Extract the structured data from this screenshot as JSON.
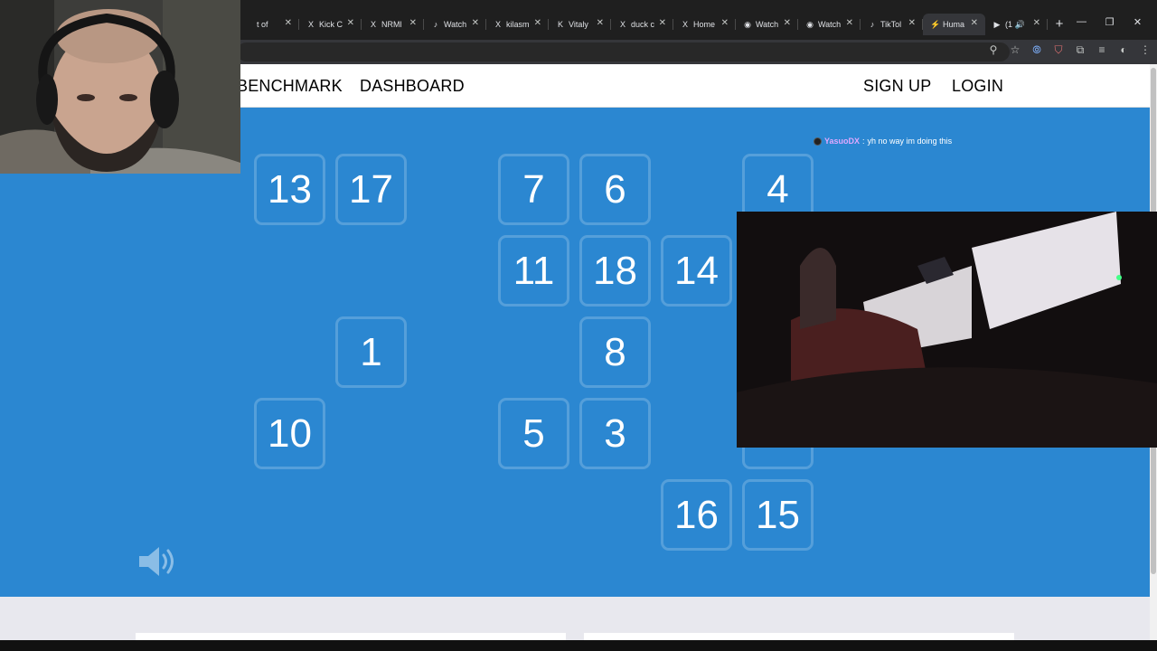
{
  "browser": {
    "tabs": [
      {
        "icon": "",
        "label": "t of",
        "active": false
      },
      {
        "icon": "X",
        "label": "Kick C",
        "active": false
      },
      {
        "icon": "X",
        "label": "NRMl",
        "active": false
      },
      {
        "icon": "♪",
        "label": "Watch",
        "active": false
      },
      {
        "icon": "X",
        "label": "kilasm",
        "active": false
      },
      {
        "icon": "K",
        "label": "Vitaly",
        "active": false
      },
      {
        "icon": "X",
        "label": "duck c",
        "active": false
      },
      {
        "icon": "X",
        "label": "Home",
        "active": false
      },
      {
        "icon": "◉",
        "label": "Watch",
        "active": false
      },
      {
        "icon": "◉",
        "label": "Watch",
        "active": false
      },
      {
        "icon": "♪",
        "label": "TikTol",
        "active": false
      },
      {
        "icon": "⚡",
        "label": "Huma",
        "active": true
      },
      {
        "icon": "▶",
        "label": "(1 🔊",
        "active": false
      }
    ],
    "new_tab": "+",
    "window_controls": [
      "—",
      "❐",
      "✕"
    ],
    "toolbar_icons": [
      "zoom-icon",
      "star-icon",
      "extension-icon",
      "extension-icon",
      "puzzle-icon",
      "media-icon",
      "profile-icon",
      "menu-icon"
    ]
  },
  "nav": {
    "benchmark": "BENCHMARK",
    "dashboard": "DASHBOARD",
    "signup": "SIGN UP",
    "login": "LOGIN"
  },
  "grid": {
    "cells": [
      {
        "value": "13",
        "col": 0,
        "row": 0
      },
      {
        "value": "17",
        "col": 1,
        "row": 0
      },
      {
        "value": "7",
        "col": 3,
        "row": 0
      },
      {
        "value": "6",
        "col": 4,
        "row": 0
      },
      {
        "value": "4",
        "col": 6,
        "row": 0
      },
      {
        "value": "11",
        "col": 3,
        "row": 1
      },
      {
        "value": "18",
        "col": 4,
        "row": 1
      },
      {
        "value": "14",
        "col": 5,
        "row": 1
      },
      {
        "value": "1",
        "col": 1,
        "row": 2
      },
      {
        "value": "8",
        "col": 4,
        "row": 2
      },
      {
        "value": "10",
        "col": 0,
        "row": 3
      },
      {
        "value": "5",
        "col": 3,
        "row": 3
      },
      {
        "value": "3",
        "col": 4,
        "row": 3
      },
      {
        "value": "",
        "col": 6,
        "row": 3
      },
      {
        "value": "16",
        "col": 5,
        "row": 4
      },
      {
        "value": "15",
        "col": 6,
        "row": 4
      }
    ]
  },
  "chat": {
    "username": "YasuoDX",
    "separator": ":",
    "message": "yh no way im doing this"
  },
  "colors": {
    "page_bg": "#2b87d1",
    "chat_user": "#e0a8ff"
  }
}
